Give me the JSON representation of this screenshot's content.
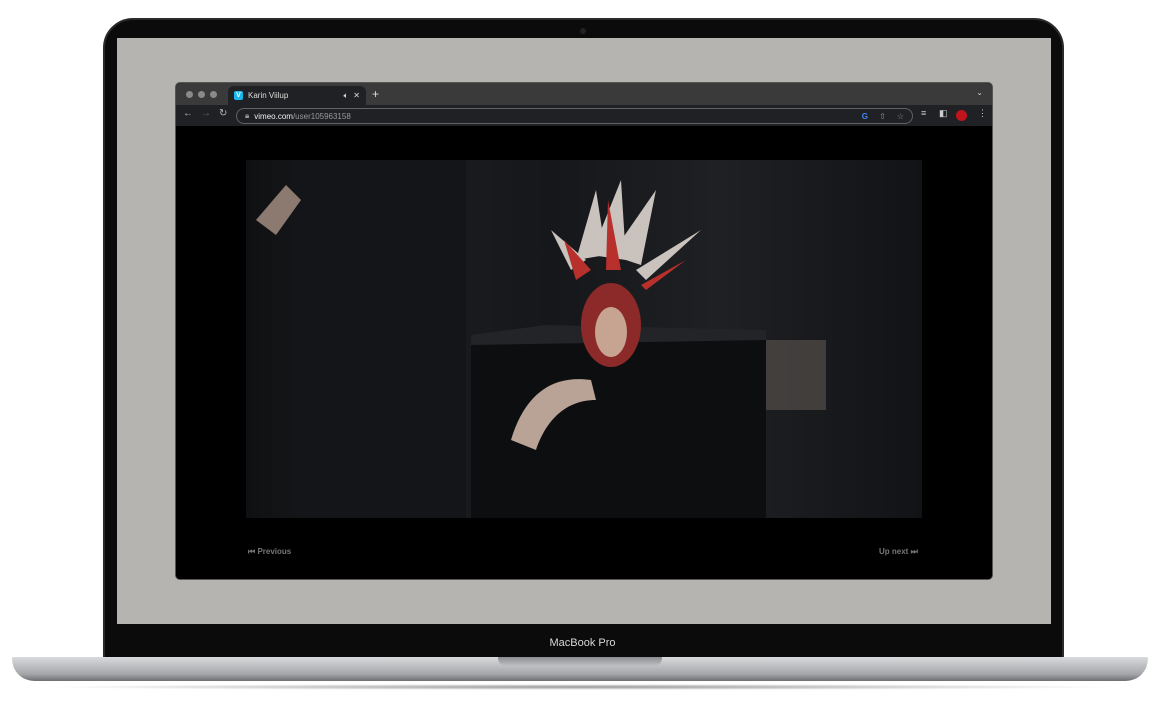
{
  "device": {
    "model_label": "MacBook Pro"
  },
  "browser": {
    "tab": {
      "title": "Karin Viilup",
      "favicon": "V",
      "audio_icon": "speaker-icon"
    },
    "new_tab": "+",
    "url_domain": "vimeo.com",
    "url_path": "/user105963158"
  },
  "page": {
    "previous_label": "Previous",
    "up_next_label": "Up next"
  }
}
